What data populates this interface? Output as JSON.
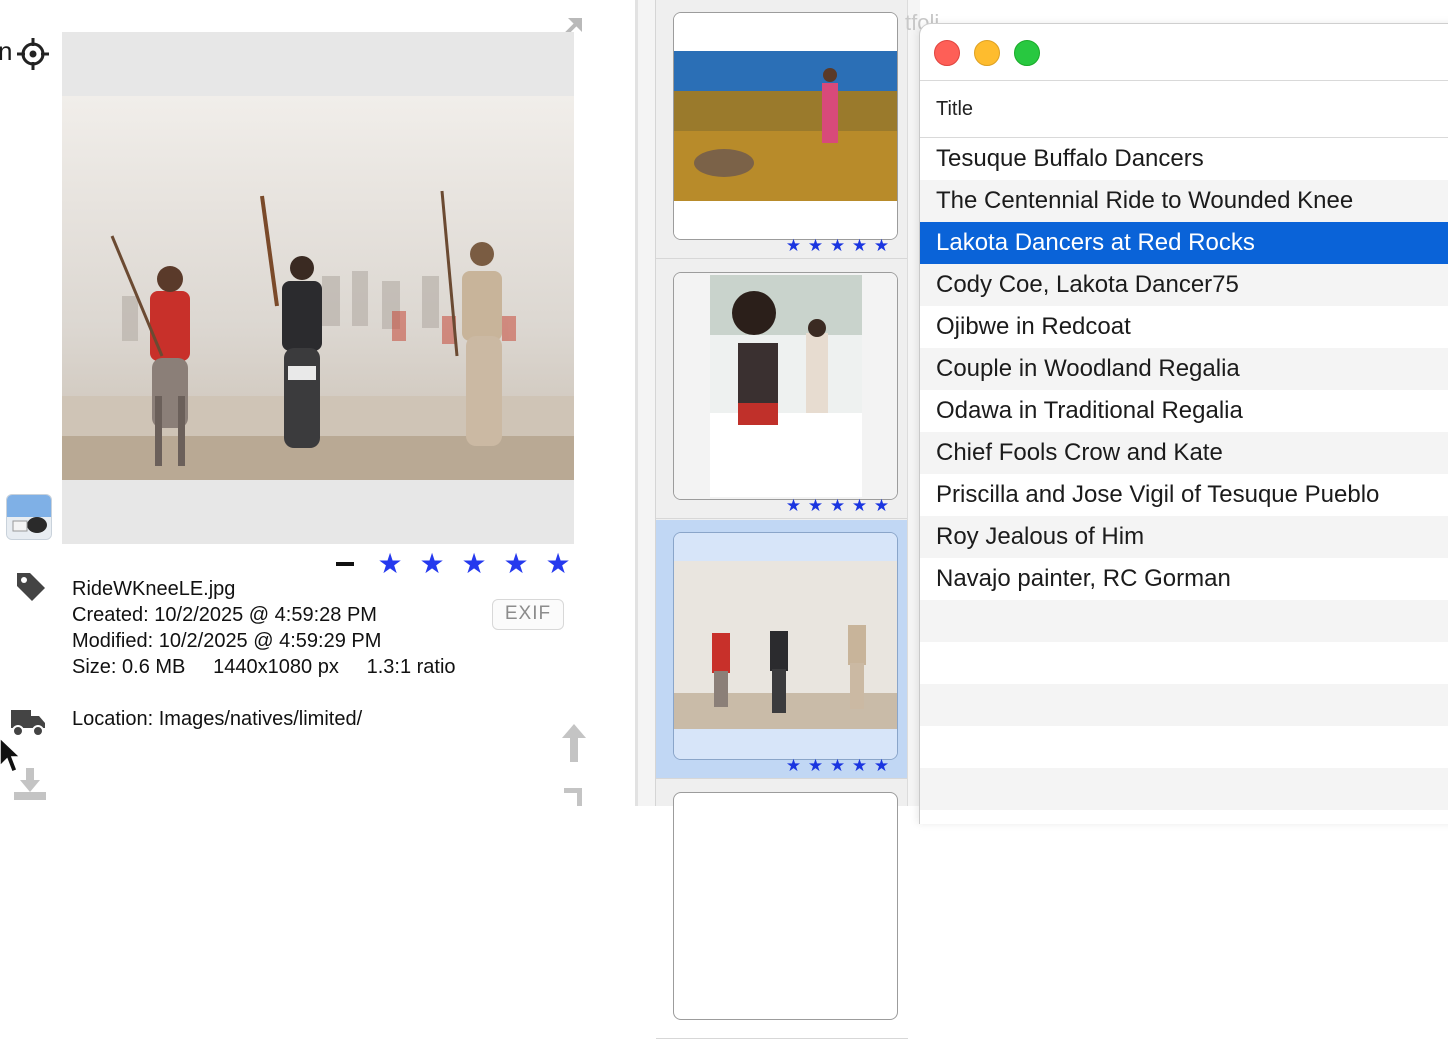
{
  "detail": {
    "truncated_heading": "n",
    "file_name": "RideWKneeLE.jpg",
    "created": "Created: 10/2/2025 @ 4:59:28 PM",
    "modified": "Modified: 10/2/2025 @ 4:59:29 PM",
    "size_line": "Size: 0.6 MB     1440x1080 px     1.3:1 ratio",
    "location": "Location: Images/natives/limited/",
    "exif_label": "EXIF",
    "rating_stars": 5,
    "star_glyphs": [
      "★",
      "★",
      "★",
      "★",
      "★"
    ]
  },
  "thumbnails": [
    {
      "stars": [
        "★",
        "★",
        "★",
        "★",
        "★"
      ],
      "rating": 5
    },
    {
      "stars": [
        "★",
        "★",
        "★",
        "★",
        "★"
      ],
      "rating": 5
    },
    {
      "stars": [
        "★",
        "★",
        "★",
        "★",
        "★"
      ],
      "rating": 5
    }
  ],
  "list_window": {
    "background_title_fragment": "tfoli",
    "column_title": "Title",
    "rows": [
      "Tesuque Buffalo Dancers",
      "The Centennial Ride to Wounded Knee",
      "Lakota Dancers at Red Rocks",
      "Cody Coe, Lakota Dancer75",
      "Ojibwe in Redcoat",
      "Couple in Woodland Regalia",
      "Odawa in Traditional Regalia",
      "Chief Fools Crow and Kate",
      "Priscilla and Jose Vigil of Tesuque Pueblo",
      "Roy Jealous of Him",
      "Navajo painter, RC Gorman"
    ],
    "selected_index": 2
  },
  "colors": {
    "star_blue": "#2539ee",
    "selection_blue": "#0a63d8",
    "thumb_selection": "#c1d7f4"
  }
}
